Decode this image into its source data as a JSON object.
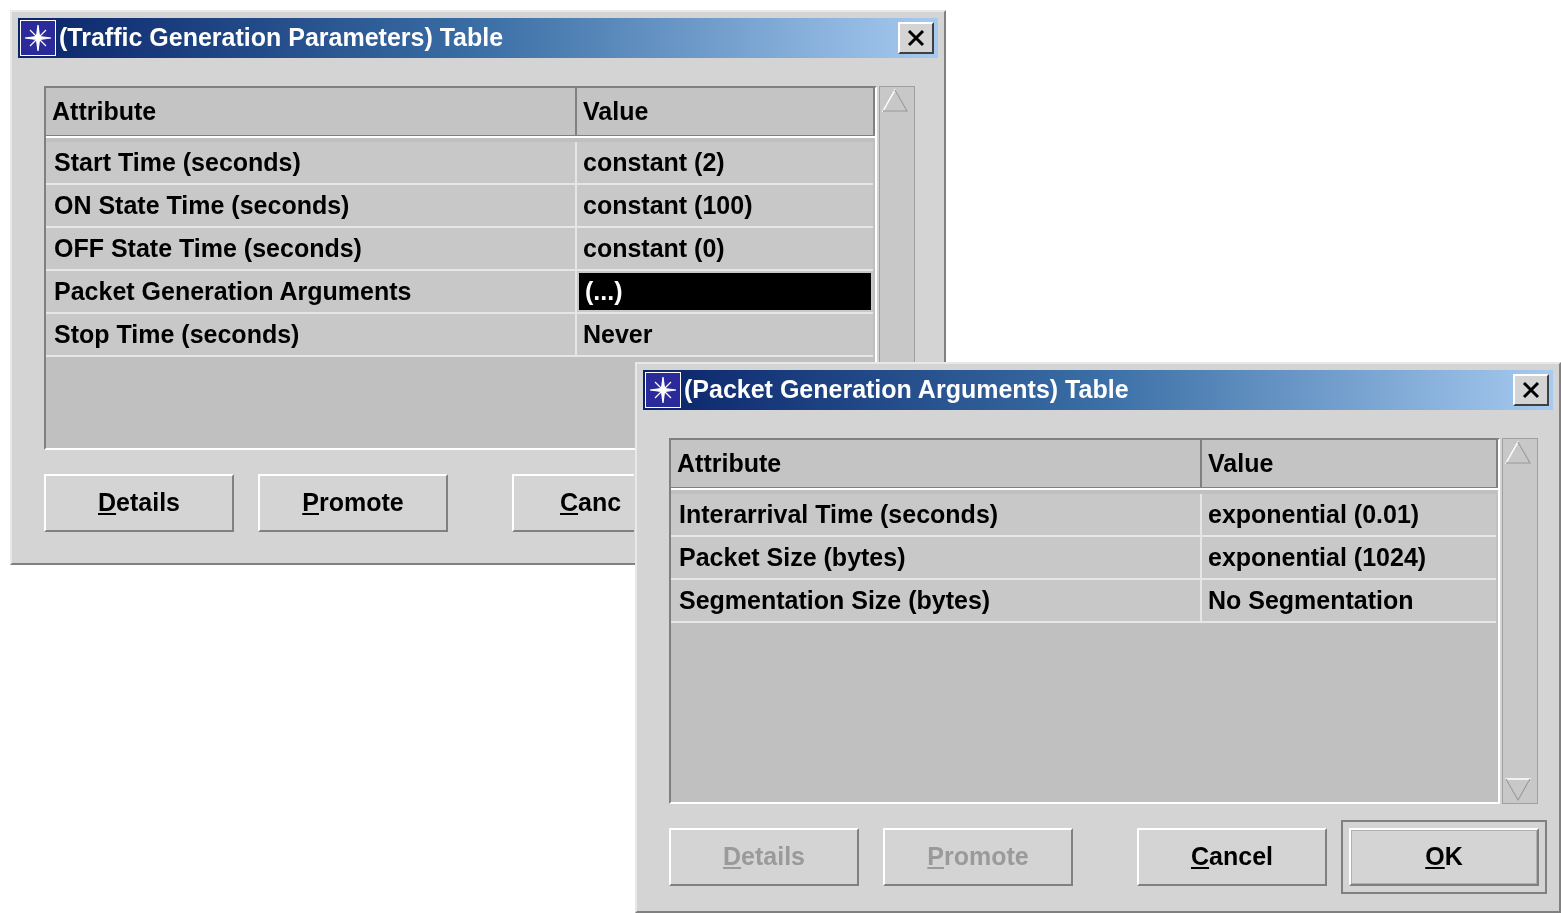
{
  "windows": [
    {
      "title": "(Traffic Generation Parameters) Table",
      "columns": [
        "Attribute",
        "Value"
      ],
      "rows": [
        {
          "attribute": "Start Time (seconds)",
          "value": "constant (2)",
          "selected": false
        },
        {
          "attribute": "ON State Time (seconds)",
          "value": "constant (100)",
          "selected": false
        },
        {
          "attribute": "OFF State Time (seconds)",
          "value": "constant (0)",
          "selected": false
        },
        {
          "attribute": "Packet Generation Arguments",
          "value": "(...)",
          "selected": true
        },
        {
          "attribute": "Stop Time (seconds)",
          "value": "Never",
          "selected": false
        }
      ],
      "buttons": [
        {
          "label": "Details",
          "disabled": false,
          "default": false
        },
        {
          "label": "Promote",
          "disabled": false,
          "default": false
        },
        {
          "label": "Canc",
          "disabled": false,
          "default": false
        }
      ]
    },
    {
      "title": "(Packet Generation Arguments) Table",
      "columns": [
        "Attribute",
        "Value"
      ],
      "rows": [
        {
          "attribute": "Interarrival Time (seconds)",
          "value": "exponential (0.01)",
          "selected": false
        },
        {
          "attribute": "Packet Size (bytes)",
          "value": "exponential (1024)",
          "selected": false
        },
        {
          "attribute": "Segmentation Size (bytes)",
          "value": "No Segmentation",
          "selected": false
        }
      ],
      "buttons": [
        {
          "label": "Details",
          "disabled": true,
          "default": false
        },
        {
          "label": "Promote",
          "disabled": true,
          "default": false
        },
        {
          "label": "Cancel",
          "disabled": false,
          "default": false
        },
        {
          "label": "OK",
          "disabled": false,
          "default": true
        }
      ]
    }
  ]
}
